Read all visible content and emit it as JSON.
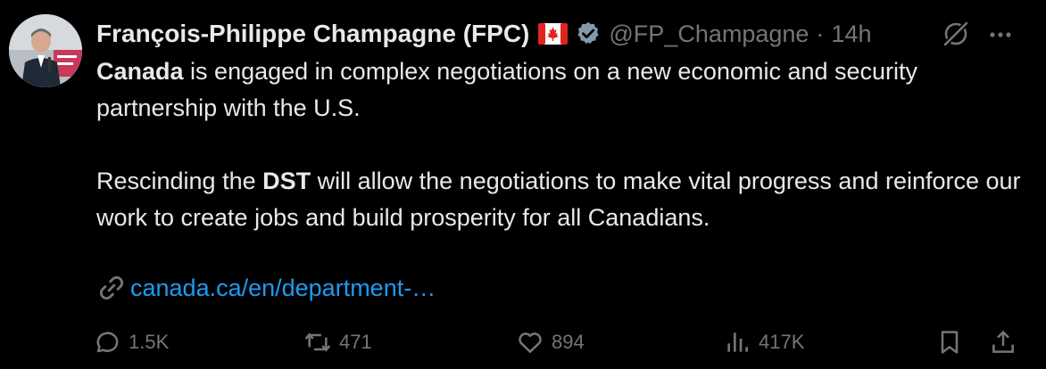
{
  "author": {
    "name": "François-Philippe Champagne (FPC)",
    "flag_icon": "canada-flag-emoji",
    "verified_icon": "verified-badge-icon",
    "handle": "@FP_Champagne",
    "separator": "·",
    "time": "14h"
  },
  "tweet": {
    "p1_bold": "Canada",
    "p1_rest": " is engaged in complex negotiations on a new economic and security partnership with the U.S.",
    "p2_pre": "Rescinding the ",
    "p2_bold": "DST",
    "p2_post": " will allow the negotiations to make vital progress and reinforce our work to create jobs and build prosperity for all Canadians.",
    "link": "canada.ca/en/department-…"
  },
  "actions": {
    "replies": "1.5K",
    "reposts": "471",
    "likes": "894",
    "views": "417K"
  },
  "colors": {
    "background": "#000000",
    "text": "#e7e9ea",
    "muted": "#71767b",
    "link": "#1d9bf0",
    "verified": "#829aab"
  }
}
